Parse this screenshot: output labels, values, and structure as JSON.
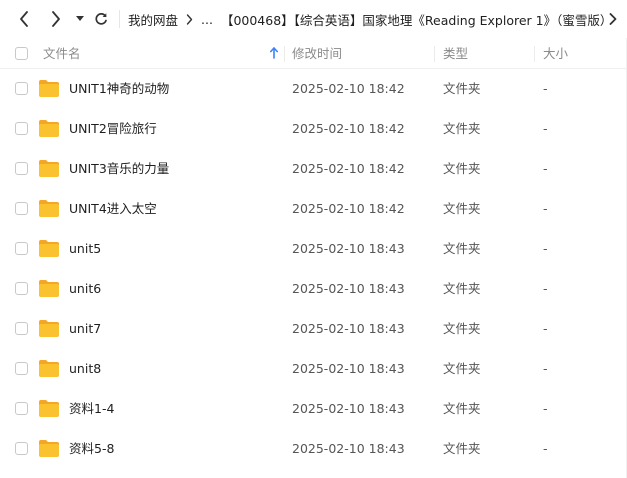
{
  "navbar": {
    "breadcrumb": {
      "root": "我的网盘",
      "ellipsis": "...",
      "current": "【000468】【综合英语】国家地理《Reading Explorer 1》（蜜雪版）"
    },
    "icons": [
      "back-icon",
      "forward-icon",
      "history-dropdown-icon",
      "refresh-icon",
      "breadcrumb-chevron-icon",
      "more-chevron-icon"
    ]
  },
  "table": {
    "headers": {
      "name": "文件名",
      "modified": "修改时间",
      "type": "类型",
      "size": "大小"
    },
    "sort": {
      "column": "name",
      "direction": "up"
    },
    "rows": [
      {
        "name": "UNIT1神奇的动物",
        "modified": "2025-02-10 18:42",
        "type": "文件夹",
        "size": "-"
      },
      {
        "name": "UNIT2冒险旅行",
        "modified": "2025-02-10 18:42",
        "type": "文件夹",
        "size": "-"
      },
      {
        "name": "UNIT3音乐的力量",
        "modified": "2025-02-10 18:42",
        "type": "文件夹",
        "size": "-"
      },
      {
        "name": "UNIT4进入太空",
        "modified": "2025-02-10 18:42",
        "type": "文件夹",
        "size": "-"
      },
      {
        "name": "unit5",
        "modified": "2025-02-10 18:43",
        "type": "文件夹",
        "size": "-"
      },
      {
        "name": "unit6",
        "modified": "2025-02-10 18:43",
        "type": "文件夹",
        "size": "-"
      },
      {
        "name": "unit7",
        "modified": "2025-02-10 18:43",
        "type": "文件夹",
        "size": "-"
      },
      {
        "name": "unit8",
        "modified": "2025-02-10 18:43",
        "type": "文件夹",
        "size": "-"
      },
      {
        "name": "资料1-4",
        "modified": "2025-02-10 18:43",
        "type": "文件夹",
        "size": "-"
      },
      {
        "name": "资料5-8",
        "modified": "2025-02-10 18:43",
        "type": "文件夹",
        "size": "-"
      }
    ]
  },
  "colors": {
    "folder": "#FBC22F",
    "folder_back": "#F5A623",
    "sort_arrow": "#3B82F6",
    "header_text": "#8a8a8a"
  }
}
